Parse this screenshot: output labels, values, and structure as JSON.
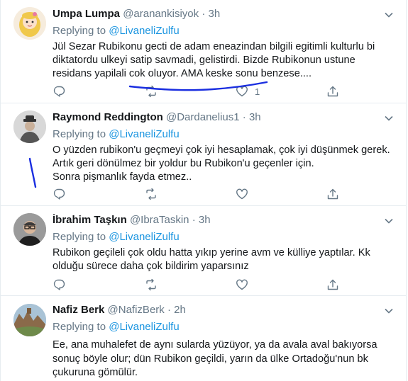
{
  "tweets": [
    {
      "name": "Umpa Lumpa",
      "handle": "@aranankisiyok",
      "time": "3h",
      "replying_label": "Replying to",
      "replying_to": "@LivaneliZulfu",
      "lines": [
        "Jül Sezar Rubikonu gecti de adam eneazindan bilgili egitimli kulturlu bi diktatordu ulkeyi satip savmadi, gelistirdi. Bizde Rubikonun ustune residans yapilali cok oluyor. AMA keske sonu benzese...."
      ],
      "like_count": "1",
      "avatar": "cartoon-girl-avatar"
    },
    {
      "name": "Raymond Reddington",
      "handle": "@Dardanelius1",
      "time": "3h",
      "replying_label": "Replying to",
      "replying_to": "@LivaneliZulfu",
      "lines": [
        "O yüzden rubikon'u geçmeyi çok iyi hesaplamak, çok iyi düşünmek gerek. Artık geri dönülmez bir yoldur bu Rubikon'u geçenler için.",
        "Sonra pişmanlık fayda etmez.."
      ],
      "like_count": "",
      "avatar": "man-in-hat-avatar"
    },
    {
      "name": "İbrahim Taşkın",
      "handle": "@IbraTaskin",
      "time": "3h",
      "replying_label": "Replying to",
      "replying_to": "@LivaneliZulfu",
      "lines": [
        "Rubikon geçileli çok oldu hatta yıkıp yerine avm ve külliye yaptılar. Kk olduğu sürece daha çok bildirim yaparsınız"
      ],
      "like_count": "",
      "avatar": "man-with-glasses-avatar"
    },
    {
      "name": "Nafiz Berk",
      "handle": "@NafizBerk",
      "time": "2h",
      "replying_label": "Replying to",
      "replying_to": "@LivaneliZulfu",
      "lines": [
        "Ee, ana muhalefet de aynı sularda yüzüyor, ya da avala aval bakıyorsa sonuç böyle olur; dün Rubikon geçildi, yarın da ülke Ortadoğu'nun bk çukuruna gömülür."
      ],
      "like_count": "",
      "avatar": "rock-landscape-avatar"
    }
  ],
  "colors": {
    "text": "#14171a",
    "secondary": "#657786",
    "link": "#1b95e0",
    "border": "#e6ecf0",
    "annotation_pen": "#1a2ee0"
  },
  "icons": [
    "reply-icon",
    "retweet-icon",
    "like-icon",
    "share-icon",
    "caret-down-icon"
  ]
}
